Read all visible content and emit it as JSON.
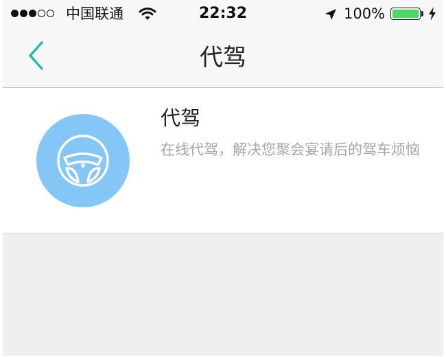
{
  "status_bar": {
    "signal_dots_filled": 3,
    "signal_dots_total": 5,
    "carrier": "中国联通",
    "time": "22:32",
    "battery_percent": "100%",
    "battery_level": 1.0,
    "icons": [
      "wifi-icon",
      "location-arrow-icon",
      "battery-icon",
      "charging-bolt-icon"
    ]
  },
  "nav": {
    "back_icon": "chevron-left-icon",
    "title": "代驾"
  },
  "service": {
    "icon": "steering-wheel-icon",
    "title": "代驾",
    "description": "在线代驾，解决您聚会宴请后的驾车烦恼"
  },
  "colors": {
    "accent": "#1dbfa6",
    "icon_circle": "#84c7f6",
    "battery": "#4cd964",
    "description_text": "#a6a6a6"
  }
}
